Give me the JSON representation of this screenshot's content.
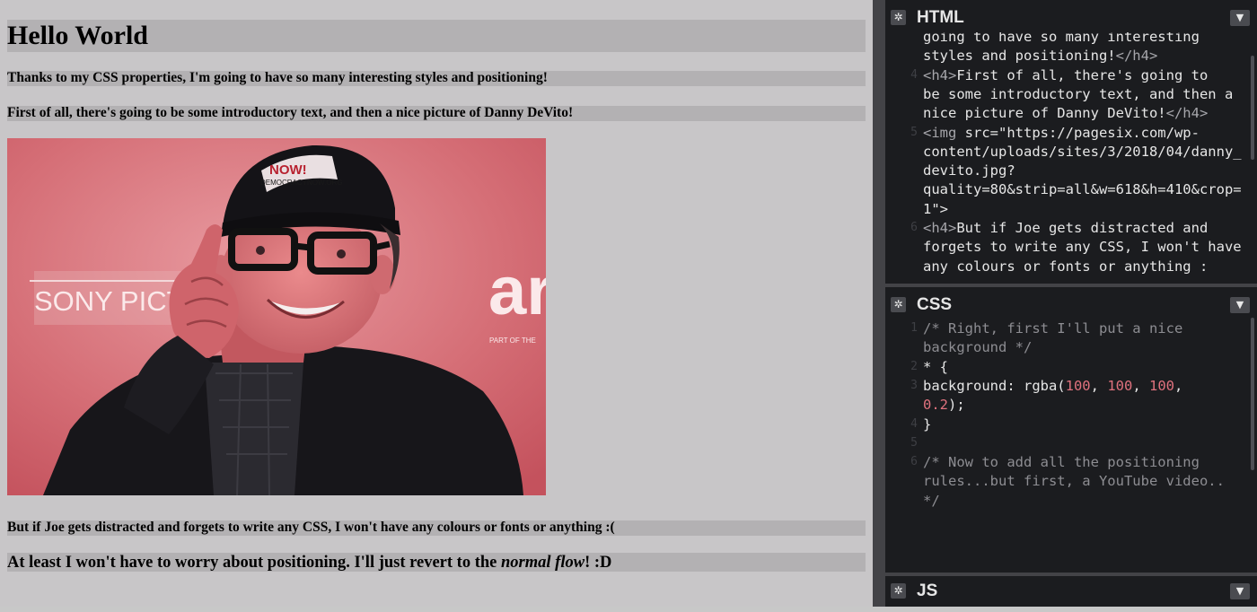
{
  "preview": {
    "title": "Hello World",
    "intro": "Thanks to my CSS properties, I'm going to have so many interesting styles and positioning!",
    "first": "First of all, there's going to be some introductory text, and then a nice picture of Danny DeVito!",
    "image_alt": "Danny DeVito",
    "photo_text": {
      "sign_left": "SONY PICT",
      "sign_right": "ar",
      "cap_badge": "DEMOCRACYNOW.ORG",
      "cap_top": "NOW!",
      "part_of": "PART OF THE"
    },
    "distracted": "But if Joe gets distracted and forgets to write any CSS, I won't have any colours or fonts or anything :(",
    "atleast_before": "At least I won't have to worry about positioning. I'll just revert to the ",
    "atleast_em": "normal flow",
    "atleast_after": "! :D"
  },
  "editor": {
    "html": {
      "title": "HTML",
      "lines": [
        {
          "num": "",
          "text": "going to have so many interesting"
        },
        {
          "num": "",
          "text": "styles and positioning!</h4>"
        },
        {
          "num": "4",
          "text": "  <h4>First of all, there's going to"
        },
        {
          "num": "",
          "text": "be some introductory text, and then a"
        },
        {
          "num": "",
          "text": "nice picture of Danny DeVito!</h4>"
        },
        {
          "num": "5",
          "text": "  <img src=\"https://pagesix.com/wp-"
        },
        {
          "num": "",
          "text": "content/uploads/sites/3/2018/04/danny_"
        },
        {
          "num": "",
          "text": "devito.jpg?"
        },
        {
          "num": "",
          "text": "quality=80&strip=all&w=618&h=410&crop="
        },
        {
          "num": "",
          "text": "1\">"
        },
        {
          "num": "6",
          "text": "  <h4>But if Joe gets distracted and"
        },
        {
          "num": "",
          "text": "forgets to write any CSS, I won't have"
        },
        {
          "num": "",
          "text": "any colours or fonts or anything :"
        }
      ]
    },
    "css": {
      "title": "CSS",
      "lines": [
        {
          "num": "1",
          "text": "/* Right, first I'll put a nice"
        },
        {
          "num": "",
          "text": "background */"
        },
        {
          "num": "2",
          "text": "* {"
        },
        {
          "num": "3",
          "text": "  background: rgba(100, 100, 100,"
        },
        {
          "num": "",
          "text": "0.2);"
        },
        {
          "num": "4",
          "text": "}"
        },
        {
          "num": "5",
          "text": ""
        },
        {
          "num": "6",
          "text": "/* Now to add all the positioning"
        },
        {
          "num": "",
          "text": "rules...but first, a YouTube video.."
        },
        {
          "num": "",
          "text": "*/"
        }
      ]
    },
    "js": {
      "title": "JS"
    },
    "icons": {
      "settings": "gear-icon",
      "collapse": "chevron-down-icon"
    }
  },
  "colors": {
    "preview_bg": "#c8c6c8",
    "band_bg": "#b3b1b3",
    "editor_bg": "#1b1c1f",
    "number_color": "#e0727e",
    "comment_color": "#8d8d92"
  }
}
